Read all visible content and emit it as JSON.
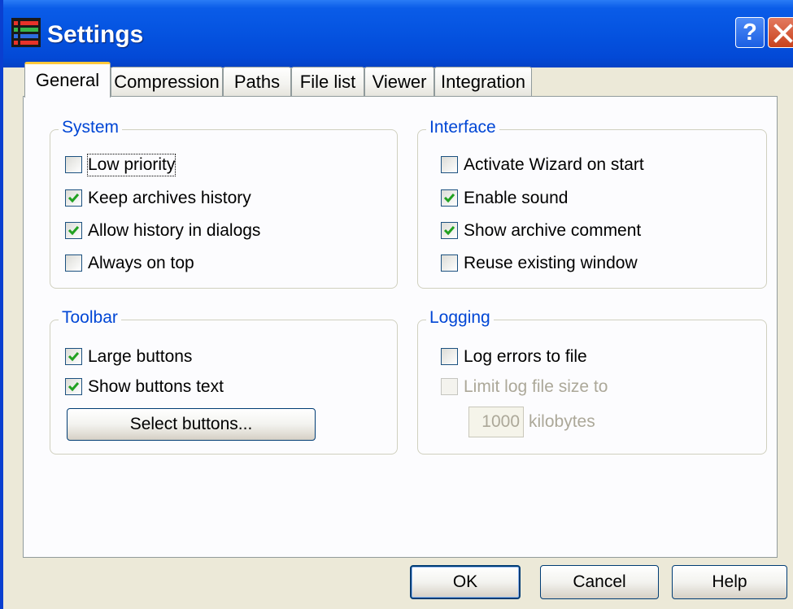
{
  "window": {
    "title": "Settings",
    "icon": "settings-list-icon",
    "help_button": "?",
    "close_button": "close-icon"
  },
  "tabs": [
    {
      "label": "General",
      "active": true
    },
    {
      "label": "Compression",
      "active": false
    },
    {
      "label": "Paths",
      "active": false
    },
    {
      "label": "File list",
      "active": false
    },
    {
      "label": "Viewer",
      "active": false
    },
    {
      "label": "Integration",
      "active": false
    }
  ],
  "system": {
    "title": "System",
    "items": [
      {
        "label": "Low priority",
        "checked": false
      },
      {
        "label": "Keep archives history",
        "checked": true
      },
      {
        "label": "Allow history in dialogs",
        "checked": true
      },
      {
        "label": "Always on top",
        "checked": false
      }
    ]
  },
  "interface": {
    "title": "Interface",
    "items": [
      {
        "label": "Activate Wizard on start",
        "checked": false
      },
      {
        "label": "Enable sound",
        "checked": true
      },
      {
        "label": "Show archive comment",
        "checked": true
      },
      {
        "label": "Reuse existing window",
        "checked": false
      }
    ]
  },
  "toolbar": {
    "title": "Toolbar",
    "items": [
      {
        "label": "Large buttons",
        "checked": true
      },
      {
        "label": "Show buttons text",
        "checked": true
      }
    ],
    "select_button": "Select buttons..."
  },
  "logging": {
    "title": "Logging",
    "items": [
      {
        "label": "Log errors to file",
        "checked": false,
        "enabled": true
      },
      {
        "label": "Limit log file size to",
        "checked": false,
        "enabled": false
      }
    ],
    "size_value": "1000",
    "size_unit": "kilobytes"
  },
  "footer": {
    "ok": "OK",
    "cancel": "Cancel",
    "help": "Help"
  },
  "colors": {
    "titlebar": "#0553e0",
    "group_title": "#0046d5",
    "check": "#21a121",
    "active_tab_accent": "#ffc83c"
  }
}
